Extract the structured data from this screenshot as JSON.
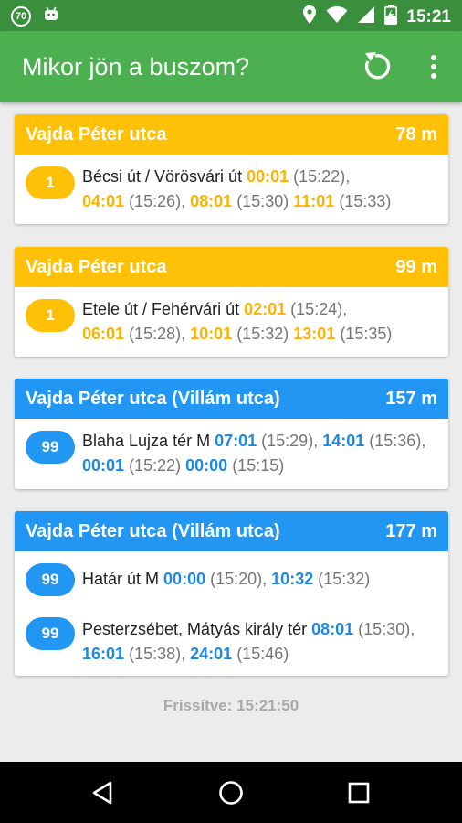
{
  "status_bar": {
    "badge": "70",
    "time": "15:21",
    "icons": [
      "android-icon",
      "location-icon",
      "wifi-icon",
      "signal-icon",
      "battery-charging-icon"
    ]
  },
  "app_bar": {
    "title": "Mikor jön a buszom?",
    "icons": [
      "refresh-icon",
      "more-vert-icon"
    ]
  },
  "stops": [
    {
      "name": "Vajda Péter utca",
      "distance": "78 m",
      "color": "#ffc107",
      "lines": [
        {
          "number": "1",
          "destination": "Bécsi út / Vörösvári út",
          "row1": [
            {
              "t": "00:01",
              "c": "(15:22),"
            }
          ],
          "row2": [
            {
              "t": "04:01",
              "c": "(15:26),"
            },
            {
              "t": "08:01",
              "c": "(15:30)"
            },
            {
              "t": "11:01",
              "c": "(15:33)"
            }
          ]
        }
      ]
    },
    {
      "name": "Vajda Péter utca",
      "distance": "99 m",
      "color": "#ffc107",
      "lines": [
        {
          "number": "1",
          "destination": "Etele út / Fehérvári út",
          "row1": [
            {
              "t": "02:01",
              "c": "(15:24),"
            }
          ],
          "row2": [
            {
              "t": "06:01",
              "c": "(15:28),"
            },
            {
              "t": "10:01",
              "c": "(15:32)"
            },
            {
              "t": "13:01",
              "c": "(15:35)"
            }
          ]
        }
      ]
    },
    {
      "name": "Vajda Péter utca (Villám utca)",
      "distance": "157 m",
      "color": "#2196f3",
      "lines": [
        {
          "number": "99",
          "destination": "Blaha Lujza tér M",
          "row1": [
            {
              "t": "07:01",
              "c": "(15:29),"
            },
            {
              "t": "14:01",
              "c": "(15:36),"
            }
          ],
          "row2": [
            {
              "t": "00:01",
              "c": "(15:22)"
            },
            {
              "t": "00:00",
              "c": "(15:15)"
            }
          ]
        }
      ]
    },
    {
      "name": "Vajda Péter utca (Villám utca)",
      "distance": "177 m",
      "color": "#2196f3",
      "lines": [
        {
          "number": "99",
          "destination": "Határ út M",
          "row1": [
            {
              "t": "00:00",
              "c": "(15:20),"
            },
            {
              "t": "10:32",
              "c": "(15:32)"
            }
          ]
        },
        {
          "number": "99",
          "destination": "Pesterzsébet, Mátyás király tér",
          "row1": [
            {
              "t": "08:01",
              "c": "(15:30),"
            }
          ],
          "row2": [
            {
              "t": "16:01",
              "c": "(15:38),"
            },
            {
              "t": "24:01",
              "c": "(15:46)"
            }
          ]
        }
      ]
    }
  ],
  "refreshed_label": "Frissítve: 15:21:50",
  "nav_bar": {
    "icons": [
      "back-icon",
      "home-icon",
      "recents-icon"
    ]
  }
}
